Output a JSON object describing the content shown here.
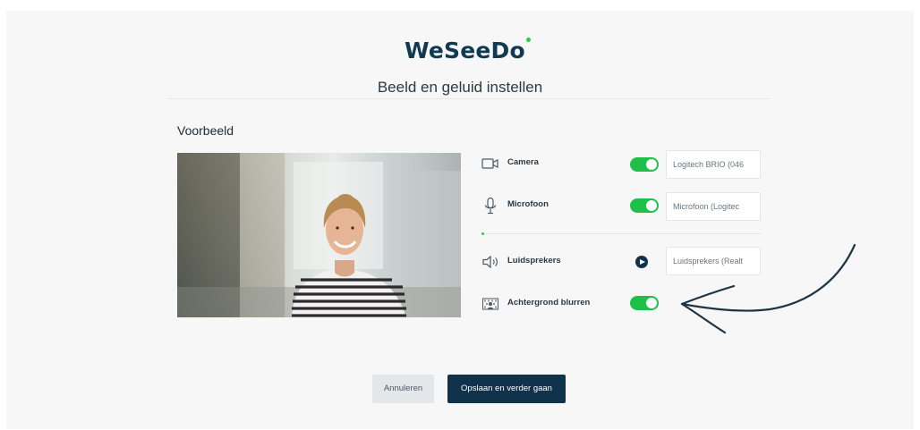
{
  "app": {
    "brand": "WeSeeDo",
    "subtitle": "Beeld en geluid instellen"
  },
  "preview": {
    "label": "Voorbeeld"
  },
  "settings": {
    "camera": {
      "label": "Camera",
      "enabled": true,
      "device": "Logitech BRIO (046",
      "icon": "camera-icon"
    },
    "microphone": {
      "label": "Microfoon",
      "enabled": true,
      "device": "Microfoon (Logitec",
      "icon": "microphone-icon"
    },
    "speakers": {
      "label": "Luidsprekers",
      "device": "Luidsprekers (Realt",
      "icon": "speaker-icon"
    },
    "background_blur": {
      "label": "Achtergrond blurren",
      "enabled": true,
      "icon": "background-blur-icon"
    }
  },
  "actions": {
    "cancel_label": "Annuleren",
    "save_label": "Opslaan en verder gaan"
  },
  "colors": {
    "brand": "#0f3a4f",
    "accent": "#1fc04a",
    "primary_button": "#10324a"
  }
}
